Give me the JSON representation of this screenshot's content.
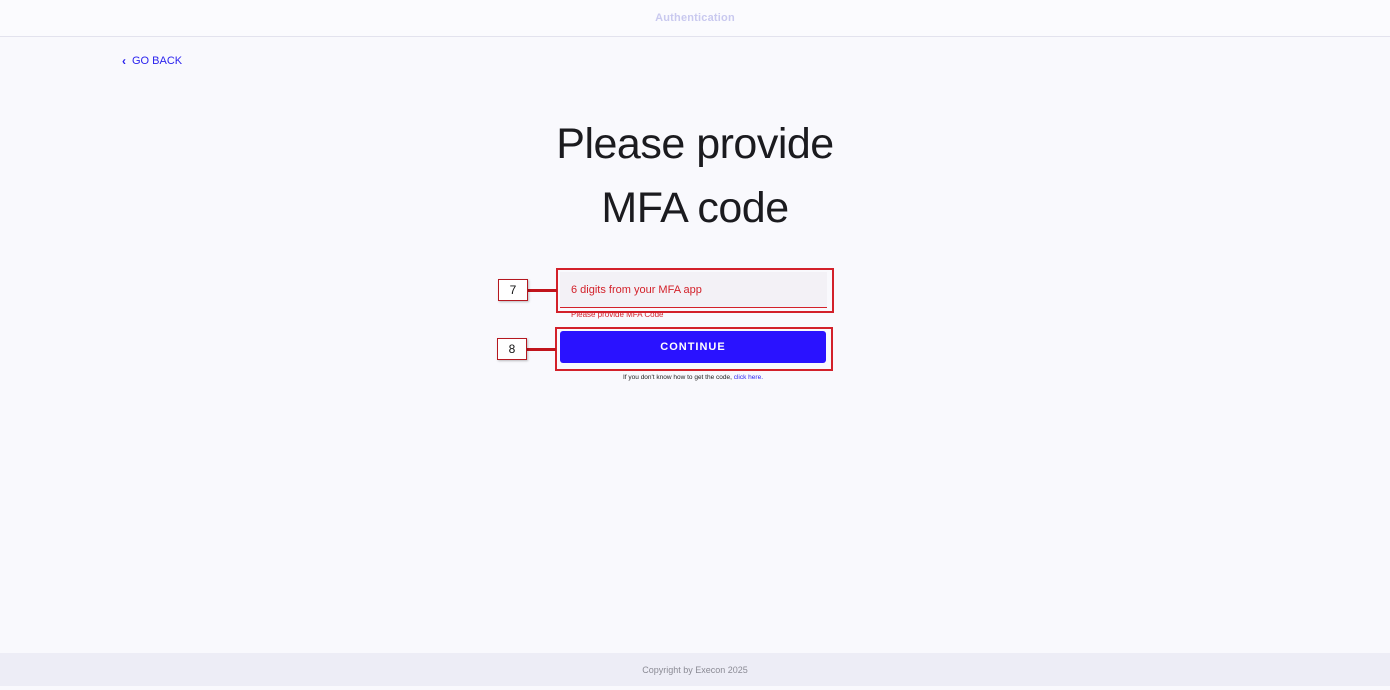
{
  "header": {
    "title": "Authentication"
  },
  "nav": {
    "back_label": "GO BACK",
    "back_icon": "chevron-left-icon"
  },
  "main": {
    "title_line1": "Please provide",
    "title_line2": "MFA code",
    "mfa_field": {
      "placeholder": "6 digits from your MFA app",
      "value": "",
      "error": "Please provide MFA Code"
    },
    "continue_label": "CONTINUE",
    "help_prefix": "If you don't know how to get the code,",
    "help_link": "click here."
  },
  "annotations": {
    "field_marker": "7",
    "button_marker": "8",
    "color": "#d3212a"
  },
  "footer": {
    "copyright": "Copyright by Execon 2025"
  },
  "colors": {
    "accent": "#2a12ff",
    "error": "#d3212a",
    "background": "#f9f9fd"
  }
}
